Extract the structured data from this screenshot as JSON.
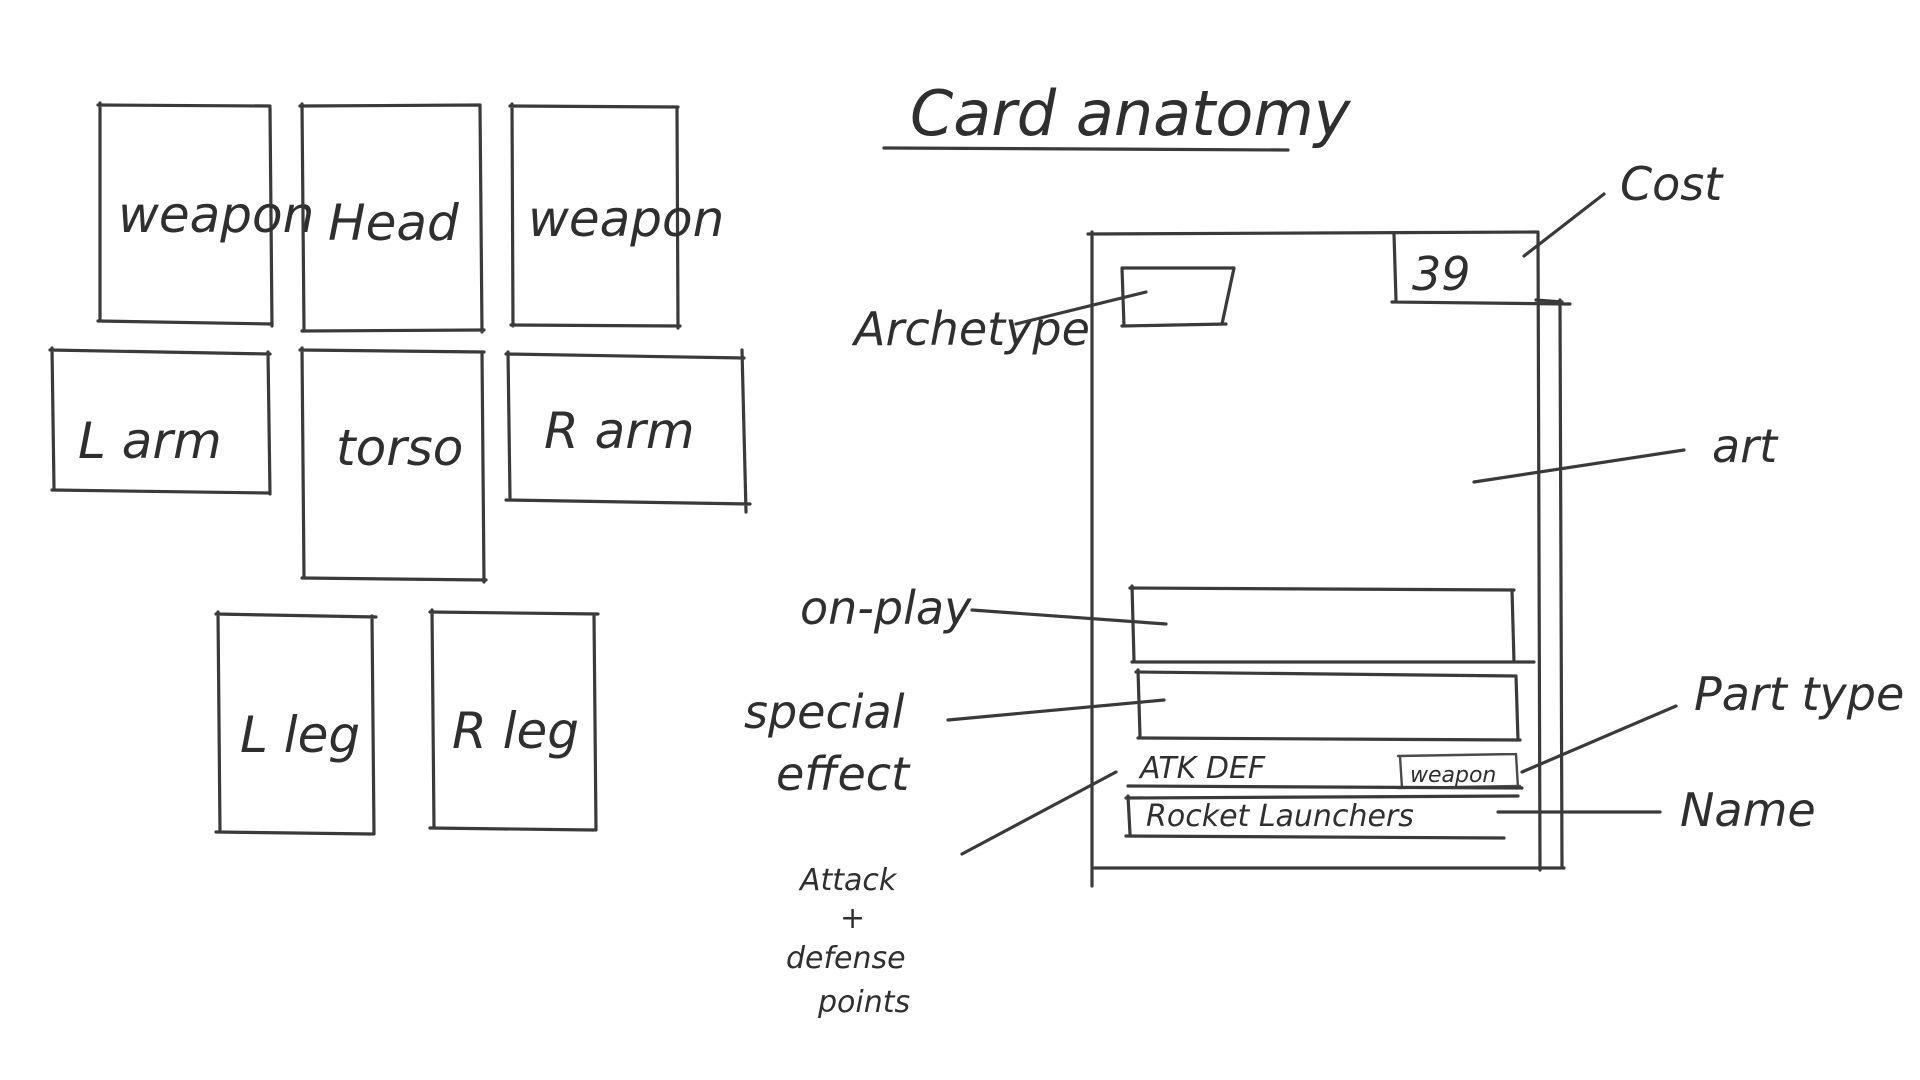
{
  "layout_sketch": {
    "slots": {
      "weapon_left": "weapon",
      "head": "Head",
      "weapon_right": "weapon",
      "left_arm": "L arm",
      "torso": "torso",
      "right_arm": "R arm",
      "left_leg": "L leg",
      "right_leg": "R leg"
    }
  },
  "card_anatomy": {
    "title": "Card anatomy",
    "card": {
      "cost_value": "39",
      "stats_label": "ATK  DEF",
      "part_type_value": "weapon",
      "name_value": "Rocket Launchers"
    },
    "callouts": {
      "cost": "Cost",
      "archetype": "Archetype",
      "art": "art",
      "on_play": "on-play",
      "special_effect_line1": "special",
      "special_effect_line2": "effect",
      "part_type": "Part type",
      "name": "Name",
      "attack_defense_line1": "Attack",
      "attack_defense_line2": "+",
      "attack_defense_line3": "defense",
      "attack_defense_line4": "points"
    }
  }
}
